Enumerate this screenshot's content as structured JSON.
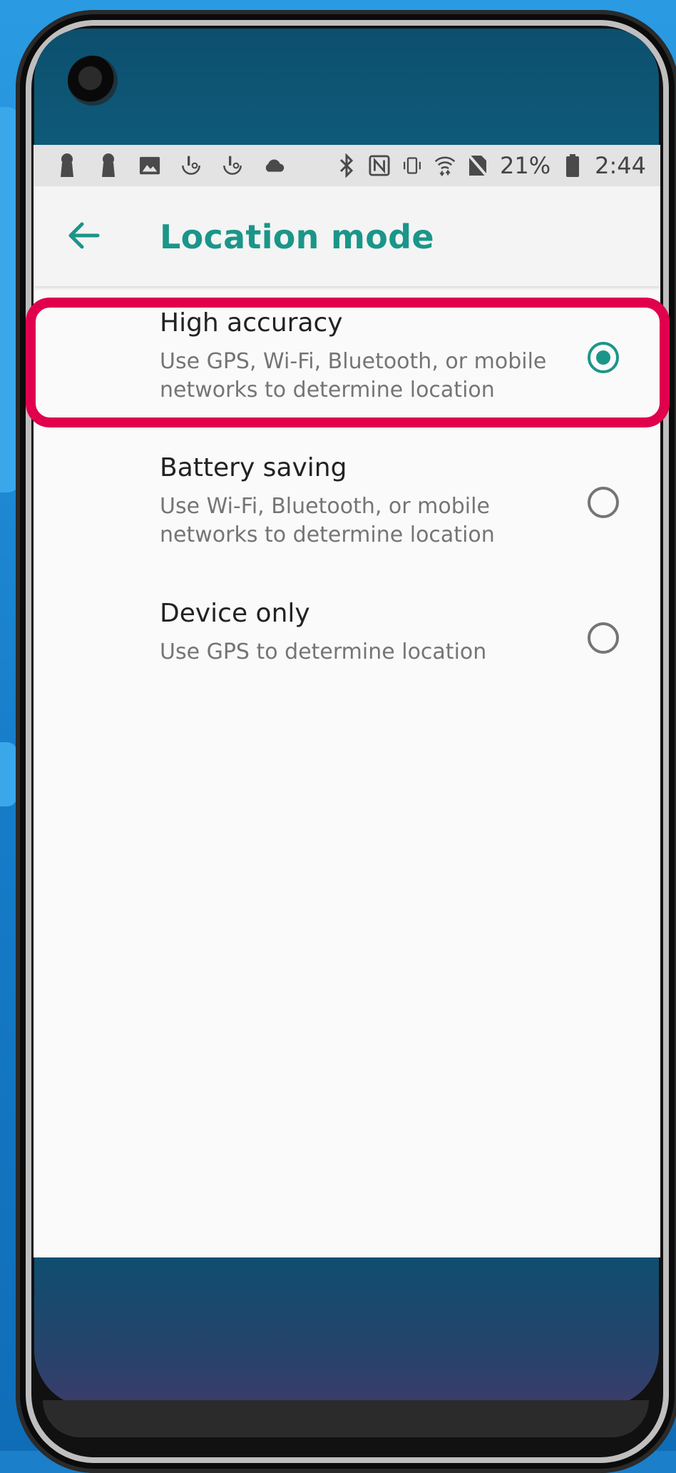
{
  "status_bar": {
    "battery_percent": "21%",
    "time": "2:44",
    "left_icons": [
      "keyhole-icon",
      "keyhole-icon",
      "image-icon",
      "touchpal-icon",
      "touchpal-icon",
      "cloud-icon"
    ],
    "right_icons": [
      "bluetooth-icon",
      "nfc-icon",
      "vibrate-icon",
      "wifi-icon",
      "no-sim-icon",
      "battery-icon"
    ]
  },
  "app_bar": {
    "title": "Location mode",
    "back_icon": "arrow-back-icon"
  },
  "options": [
    {
      "title": "High accuracy",
      "subtitle": "Use GPS, Wi-Fi, Bluetooth, or mobile networks to determine location",
      "selected": true
    },
    {
      "title": "Battery saving",
      "subtitle": "Use Wi-Fi, Bluetooth, or mobile networks to determine location",
      "selected": false
    },
    {
      "title": "Device only",
      "subtitle": "Use GPS to determine location",
      "selected": false
    }
  ],
  "colors": {
    "accent": "#1a9689",
    "highlight": "#e0004d"
  }
}
